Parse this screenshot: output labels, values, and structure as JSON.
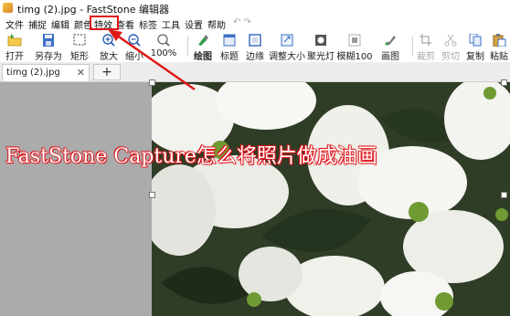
{
  "window": {
    "title": "timg (2).jpg - FastStone 编辑器"
  },
  "menu": [
    "文件",
    "捕捉",
    "编辑",
    "颜色",
    "特效",
    "查看",
    "标签",
    "工具",
    "设置",
    "帮助"
  ],
  "highlighted_menu": "特效",
  "toolbar": {
    "open": "打开",
    "save_as": "另存为",
    "rect": "矩形",
    "zoom_in": "放大",
    "zoom_out": "缩小",
    "zoom_level": "100%",
    "draw": "绘图",
    "caption": "标题",
    "edge": "边缘",
    "resize": "调整大小",
    "spotlight": "聚光灯",
    "blur": "模糊100",
    "paint": "画图",
    "crop": "裁剪",
    "cut": "剪切",
    "copy": "复制",
    "paste": "粘贴"
  },
  "tabs": [
    {
      "label": "timg (2).jpg"
    }
  ],
  "overlay_title": "FastStone Capture怎么将照片做成油画",
  "colors": {
    "annotation_red": "#e01818",
    "workspace_gray": "#ababab"
  }
}
